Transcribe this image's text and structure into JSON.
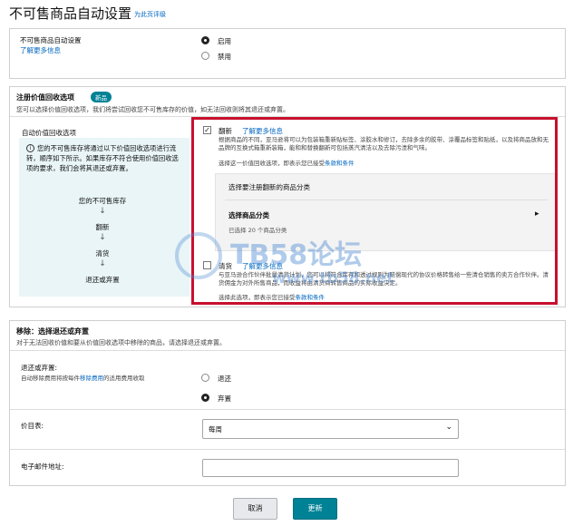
{
  "page": {
    "title": "不可售商品自动设置",
    "title_link": "为此页评级"
  },
  "auto_setting": {
    "label": "不可售商品自动设置",
    "learn_more": "了解更多信息",
    "options": [
      {
        "label": "启用",
        "selected": true
      },
      {
        "label": "禁用",
        "selected": false
      }
    ]
  },
  "recovery": {
    "heading": "注册价值回收选项",
    "badge": "新品",
    "desc": "您可以选择价值回收选项，我们将尝试回收您不可售库存的价值，如无法回收则将其退还或弃置。",
    "left_label": "自动价值回收选项",
    "info_text": "您的不可售库存将通过以下价值回收选项进行流转，顺序如下所示。如果库存不符合使用价值回收选项的要求，我们会将其退还或弃置。",
    "flow": [
      "您的不可售库存",
      "翻新",
      "清货",
      "退还或弃置"
    ],
    "arrow": "↓",
    "refurb": {
      "checked": true,
      "check_mark": "✓",
      "label": "翻新",
      "learn_more": "了解更多信息",
      "desc": "根据商品的不同，亚马逊将可以为包装箱重新贴标签、涂胶水和修订，去除多余的胶带、涂覆品标签和贴纸，以及将商品放和无品牌的互换式箱重新装箱，能和和替换翻新可包括蒸汽清洁以及去除污渍和气味。",
      "terms_prefix": "选择这一价值回收选项，即表示您已接受",
      "terms_link": "条款和条件",
      "subpanel": {
        "title": "选择要注册翻新的商品分类",
        "select_label": "选择商品分类",
        "chevron": "▸",
        "selected_count": "已选择 20 个商品分类"
      }
    },
    "liquidate": {
      "checked": false,
      "label": "清货",
      "learn_more": "了解更多信息",
      "desc": "与亚马逊合作伙伴批量清货计划，您可以将符合库存和透过规则为赔偿现代的协议价格转售给一些清仓销售的卖方合作伙伴。清货佣金为对外所售商品，而收益将由清货商转售商品的实际收益决定。",
      "terms_prefix": "选择此选项，即表示您已接受",
      "terms_link": "条款和条件"
    }
  },
  "removal": {
    "heading": "移除：选择退还或弃置",
    "desc": "对于无法回收价值和要从价值回收选项中移除的商品，请选择退还或弃置。",
    "return_label": "退还或弃置:",
    "return_desc_prefix": "自动移除费用将按每件",
    "return_desc_link": "移除费用",
    "return_desc_suffix": "的适用费用收取",
    "options": [
      {
        "label": "退还",
        "selected": false
      },
      {
        "label": "弃置",
        "selected": true
      }
    ],
    "frequency_label": "价目表:",
    "frequency_value": "每周",
    "frequency_chevron": "⌄",
    "email_label": "电子邮件地址:",
    "email_value": ""
  },
  "buttons": {
    "cancel": "取消",
    "update": "更新"
  },
  "watermark": {
    "text": "TB58论坛",
    "url": "www.tb58.net"
  }
}
